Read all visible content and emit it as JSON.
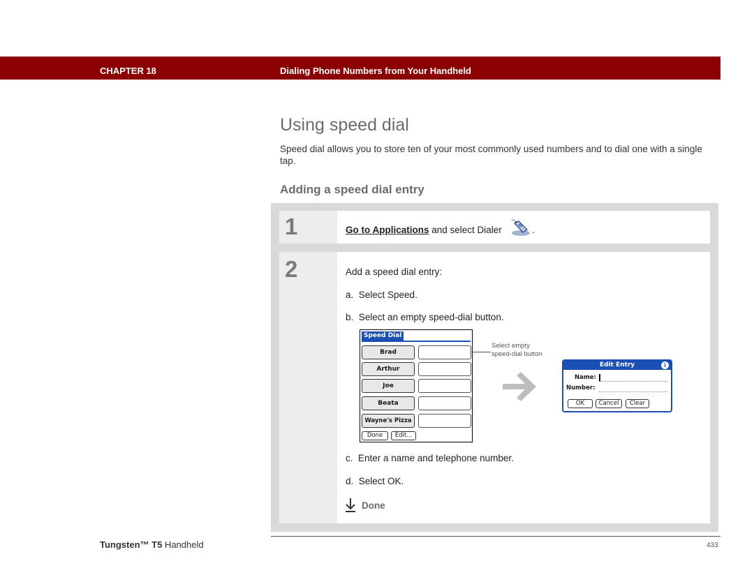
{
  "header": {
    "chapter": "CHAPTER 18",
    "title": "Dialing Phone Numbers from Your Handheld"
  },
  "section_title": "Using speed dial",
  "intro": "Speed dial allows you to store ten of your most commonly used numbers and to dial one with a single tap.",
  "subsection_title": "Adding a speed dial entry",
  "steps": [
    {
      "number": "1",
      "link": "Go to Applications",
      "text": " and select Dialer",
      "end": "."
    },
    {
      "number": "2",
      "lead": "Add a speed dial entry:",
      "items": [
        "a.  Select Speed.",
        "b.  Select an empty speed-dial button.",
        "c.  Enter a name and telephone number.",
        "d.  Select OK."
      ]
    }
  ],
  "speed_dial_screen": {
    "title": "Speed Dial",
    "buttons": [
      "Brad",
      "Arthur",
      "Joe",
      "Beata",
      "Wayne's Pizza"
    ],
    "done": "Done",
    "edit": "Edit..."
  },
  "callout": {
    "line1": "Select empty",
    "line2": "speed-dial button"
  },
  "edit_entry": {
    "title": "Edit Entry",
    "info": "i",
    "name_label": "Name:",
    "number_label": "Number:",
    "ok": "OK",
    "cancel": "Cancel",
    "clear": "Clear"
  },
  "done_label": "Done",
  "footer": {
    "product_bold": "Tungsten™ T5",
    "product_rest": " Handheld",
    "page": "433"
  },
  "colors": {
    "banner": "#8b0000",
    "palm_blue": "#1c4fb3"
  },
  "icons": [
    "dialer-icon",
    "arrow-right-icon",
    "done-arrow-icon",
    "info-icon"
  ]
}
